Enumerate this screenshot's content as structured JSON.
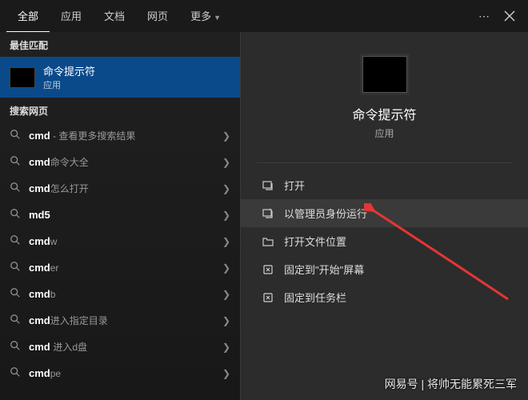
{
  "tabs": {
    "items": [
      "全部",
      "应用",
      "文档",
      "网页",
      "更多"
    ],
    "active_index": 0
  },
  "sections": {
    "best_match_header": "最佳匹配",
    "web_header": "搜索网页"
  },
  "best_match": {
    "title": "命令提示符",
    "subtitle": "应用"
  },
  "web_results": [
    {
      "prefix": "cmd",
      "suffix": " - 查看更多搜索结果"
    },
    {
      "prefix": "cmd",
      "suffix": "命令大全"
    },
    {
      "prefix": "cmd",
      "suffix": "怎么打开"
    },
    {
      "prefix": "md5",
      "suffix": ""
    },
    {
      "prefix": "cmd",
      "suffix": "w"
    },
    {
      "prefix": "cmd",
      "suffix": "er"
    },
    {
      "prefix": "cmd",
      "suffix": "b"
    },
    {
      "prefix": "cmd",
      "suffix": "进入指定目录"
    },
    {
      "prefix": "cmd ",
      "suffix": "进入d盘"
    },
    {
      "prefix": "cmd",
      "suffix": "pe"
    }
  ],
  "preview": {
    "title": "命令提示符",
    "subtitle": "应用"
  },
  "actions": [
    {
      "icon": "open",
      "label": "打开",
      "highlight": false
    },
    {
      "icon": "admin",
      "label": "以管理员身份运行",
      "highlight": true
    },
    {
      "icon": "folder",
      "label": "打开文件位置",
      "highlight": false
    },
    {
      "icon": "pin-start",
      "label": "固定到\"开始\"屏幕",
      "highlight": false
    },
    {
      "icon": "pin-taskbar",
      "label": "固定到任务栏",
      "highlight": false
    }
  ],
  "watermark": "网易号 | 将帅无能累死三军"
}
